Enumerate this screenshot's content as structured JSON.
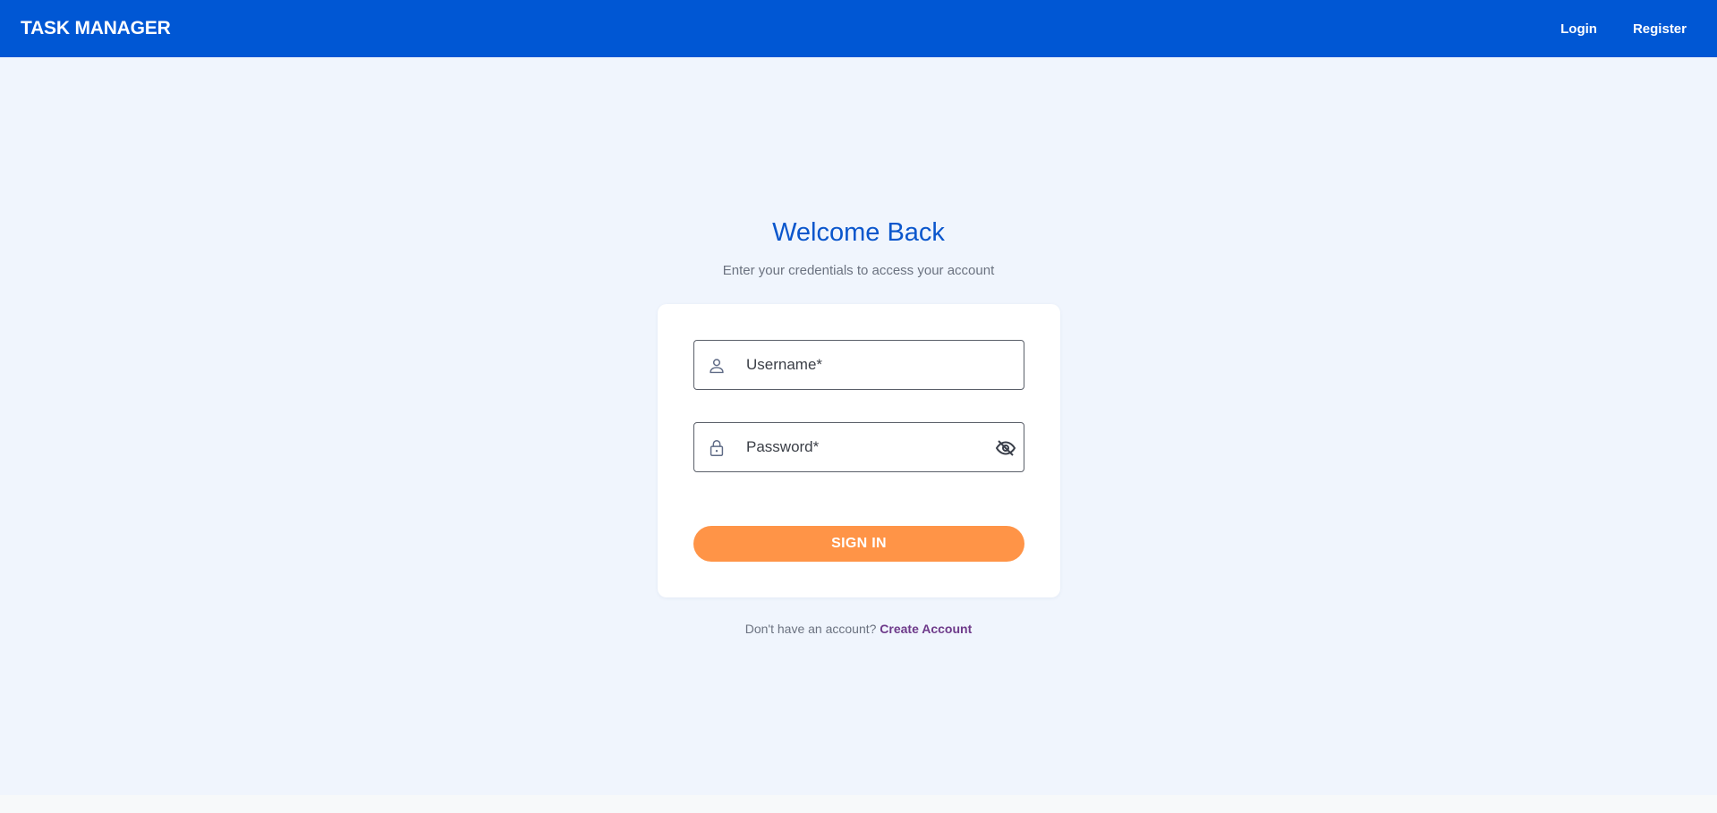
{
  "header": {
    "brand": "TASK MANAGER",
    "nav": [
      {
        "label": "Login"
      },
      {
        "label": "Register"
      }
    ]
  },
  "login": {
    "title": "Welcome Back",
    "subtitle": "Enter your credentials to access your account",
    "username": {
      "placeholder": "Username*",
      "value": "",
      "icon": "person-icon"
    },
    "password": {
      "placeholder": "Password*",
      "value": "",
      "icon": "lock-icon",
      "toggle_icon": "eye-off-icon"
    },
    "submit_label": "SIGN IN",
    "signup_prompt": "Don't have an account?",
    "signup_link": "Create Account"
  },
  "colors": {
    "header": "#0057d4",
    "page_background": "#f0f5fd",
    "title": "#0a56cc",
    "submit": "#ff9447",
    "link": "#6e3a8a"
  }
}
